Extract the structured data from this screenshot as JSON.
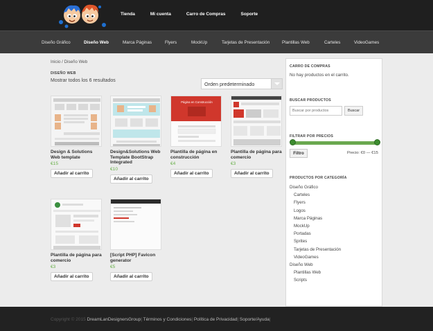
{
  "header": {
    "nav": [
      "Tienda",
      "Mi cuenta",
      "Carro de Compras",
      "Soporte"
    ]
  },
  "categories": {
    "items": [
      "Diseño Gráfico",
      "Diseño Web",
      "Marca Páginas",
      "Flyers",
      "MockUp",
      "Tarjetas de Presentación",
      "Plantillas Web",
      "Carteles",
      "VideoGames"
    ],
    "active": "Diseño Web"
  },
  "breadcrumb": "Inicio / Diseño Web",
  "page": {
    "heading": "DISEÑO WEB",
    "results": "Mostrar todos los 6 resultados",
    "ordering": "Orden predeterminado"
  },
  "products": [
    {
      "title": "Design & Solutions Web template",
      "price": "€15",
      "button": "Añadir al carrito"
    },
    {
      "title": "Design&Solutions Web Template BootStrap Integrated",
      "price": "€10",
      "button": "Añadir al carrito"
    },
    {
      "title": "Plantilla de página en construcción",
      "price": "€4",
      "button": "Añadir al carrito",
      "thumb_text": "Página en Construcción"
    },
    {
      "title": "Plantilla de página para comercio",
      "price": "€3",
      "button": "Añadir al carrito"
    },
    {
      "title": "Plantilla de página para comercio",
      "price": "€3",
      "button": "Añadir al carrito"
    },
    {
      "title": "[Script PHP] Favicon generator",
      "price": "€5",
      "button": "Añadir al carrito"
    }
  ],
  "sidebar": {
    "cart_title": "CARRO DE COMPRAS",
    "cart_empty": "No hay productos en el carrito.",
    "search_title": "BUSCAR PRODUCTOS",
    "search_placeholder": "Buscar por productos",
    "search_button": "Buscar",
    "filter_title": "FILTRAR POR PRECIOS",
    "filter_button": "Filtro",
    "price_range": "Precio: €0 — €15",
    "price_min": 0,
    "price_max": 15,
    "categories_title": "PRODUCTOS POR CATEGORÍA",
    "category_tree": [
      {
        "label": "Diseño Gráfico",
        "level": 0
      },
      {
        "label": "Carteles",
        "level": 1
      },
      {
        "label": "Flyers",
        "level": 1
      },
      {
        "label": "Logos",
        "level": 1
      },
      {
        "label": "Marca Páginas",
        "level": 1
      },
      {
        "label": "MockUp",
        "level": 1
      },
      {
        "label": "Portadas",
        "level": 1
      },
      {
        "label": "Sprites",
        "level": 1
      },
      {
        "label": "Tarjetas de Presentación",
        "level": 1
      },
      {
        "label": "VideoGames",
        "level": 1
      },
      {
        "label": "Diseño Web",
        "level": 0
      },
      {
        "label": "Plantillas Web",
        "level": 1
      },
      {
        "label": "Scripts",
        "level": 1
      }
    ]
  },
  "footer": {
    "copyright": "Copyright © 2015",
    "links": [
      "DreamLanDesignersGroup",
      "Términos y Condiciones",
      "Política de Privacidad",
      "Soporte/Ayuda"
    ]
  },
  "colors": {
    "topbar": "#1f1f1f",
    "catbar": "#3b3b3b",
    "price_green": "#6ab04c",
    "slider_green": "#3d8c2f",
    "footer": "#222222"
  }
}
